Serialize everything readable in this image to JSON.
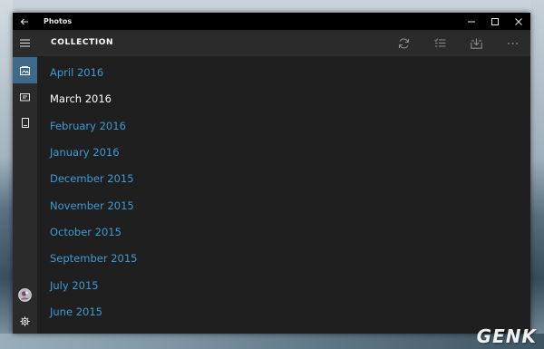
{
  "window": {
    "title": "Photos"
  },
  "header": {
    "title": "COLLECTION"
  },
  "months": [
    {
      "label": "April 2016",
      "current": false
    },
    {
      "label": "March 2016",
      "current": true
    },
    {
      "label": "February 2016",
      "current": false
    },
    {
      "label": "January 2016",
      "current": false
    },
    {
      "label": "December 2015",
      "current": false
    },
    {
      "label": "November 2015",
      "current": false
    },
    {
      "label": "October 2015",
      "current": false
    },
    {
      "label": "September 2015",
      "current": false
    },
    {
      "label": "July 2015",
      "current": false
    },
    {
      "label": "June 2015",
      "current": false
    }
  ],
  "rail": {
    "items": [
      {
        "name": "menu",
        "icon": "hamburger-icon"
      },
      {
        "name": "collection",
        "icon": "collection-icon",
        "selected": true
      },
      {
        "name": "albums",
        "icon": "album-icon"
      },
      {
        "name": "folders",
        "icon": "folder-icon"
      },
      {
        "name": "account",
        "icon": "avatar-icon"
      },
      {
        "name": "settings",
        "icon": "gear-icon"
      }
    ]
  },
  "header_actions": [
    "refresh-icon",
    "select-icon",
    "import-icon",
    "more-icon"
  ],
  "watermark": "GENK",
  "colors": {
    "accent": "#3c9bd6",
    "selected_rail": "#3d6a8a",
    "background": "#1f1f1f",
    "bar": "#2b2b2b",
    "titlebar": "#000000"
  }
}
